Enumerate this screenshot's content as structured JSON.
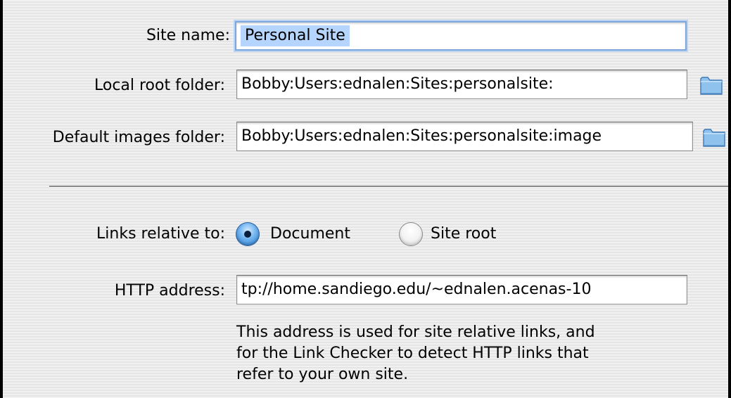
{
  "site_name": {
    "label": "Site name:",
    "value": "Personal Site"
  },
  "local_root": {
    "label": "Local root folder:",
    "value": "Bobby:Users:ednalen:Sites:personalsite:",
    "browse_icon": "folder-icon"
  },
  "default_images": {
    "label": "Default images folder:",
    "value": "Bobby:Users:ednalen:Sites:personalsite:image",
    "browse_icon": "folder-icon"
  },
  "links_relative": {
    "label": "Links relative to:",
    "options": [
      {
        "label": "Document",
        "selected": true
      },
      {
        "label": "Site root",
        "selected": false
      }
    ]
  },
  "http_address": {
    "label": "HTTP address:",
    "value": "tp://home.sandiego.edu/~ednalen.acenas-10"
  },
  "help_text": {
    "lines": [
      "This address is used for site relative links, and",
      "for the Link Checker to detect HTTP links that",
      "refer to your own site."
    ]
  },
  "colors": {
    "selection": "#b5d5ff",
    "focus_ring": "#7ba7dc",
    "radio_selected": "#2a79cf",
    "folder": "#8fc3ee"
  }
}
